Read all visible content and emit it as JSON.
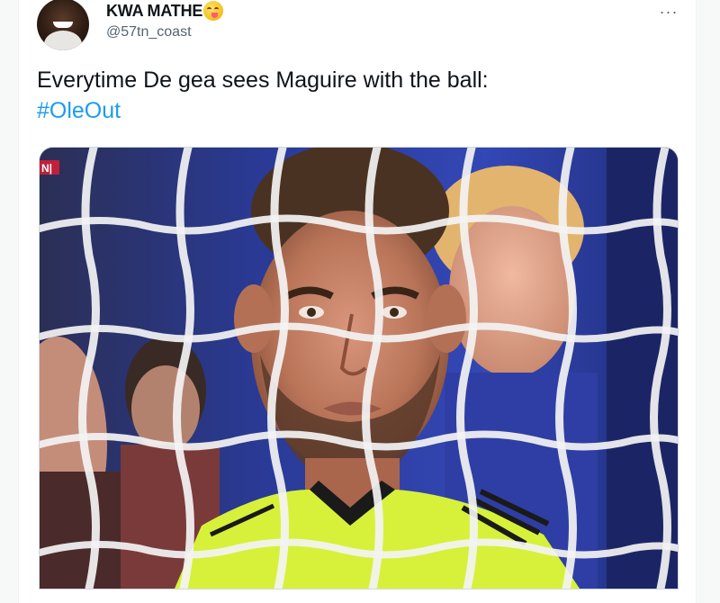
{
  "tweet": {
    "display_name": "KWA MATHE",
    "handle": "@57tn_coast",
    "text": "Everytime De gea sees Maguire with the ball:",
    "hashtag": "#OleOut",
    "more_label": "···"
  },
  "media": {
    "channel_logo": "N|"
  },
  "colors": {
    "link": "#1d9bf0",
    "text": "#0f1419",
    "secondary": "#536471",
    "jersey": "#d7f13a"
  },
  "icons": {
    "emoji": "face-savoring-food-emoji",
    "more": "more-options-icon"
  }
}
